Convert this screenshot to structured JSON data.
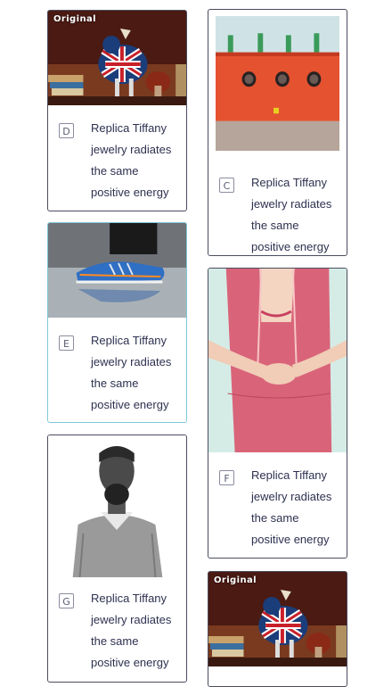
{
  "cards": [
    {
      "letter": "D",
      "tag": "Original",
      "caption": "Replica Tiffany jewelry radiates the same positive energy"
    },
    {
      "letter": "C",
      "caption": "Replica Tiffany jewelry radiates the same positive energy"
    },
    {
      "letter": "E",
      "caption": "Replica Tiffany jewelry radiates the same positive energy"
    },
    {
      "letter": "F",
      "caption": "Replica Tiffany jewelry radiates the same positive energy"
    },
    {
      "letter": "G",
      "caption": "Replica Tiffany jewelry radiates the same positive energy"
    },
    {
      "tag": "Original"
    }
  ],
  "colors": {
    "border": "#4a4d5e",
    "highlight_border": "#7fc7d9",
    "text": "#2e3150"
  }
}
